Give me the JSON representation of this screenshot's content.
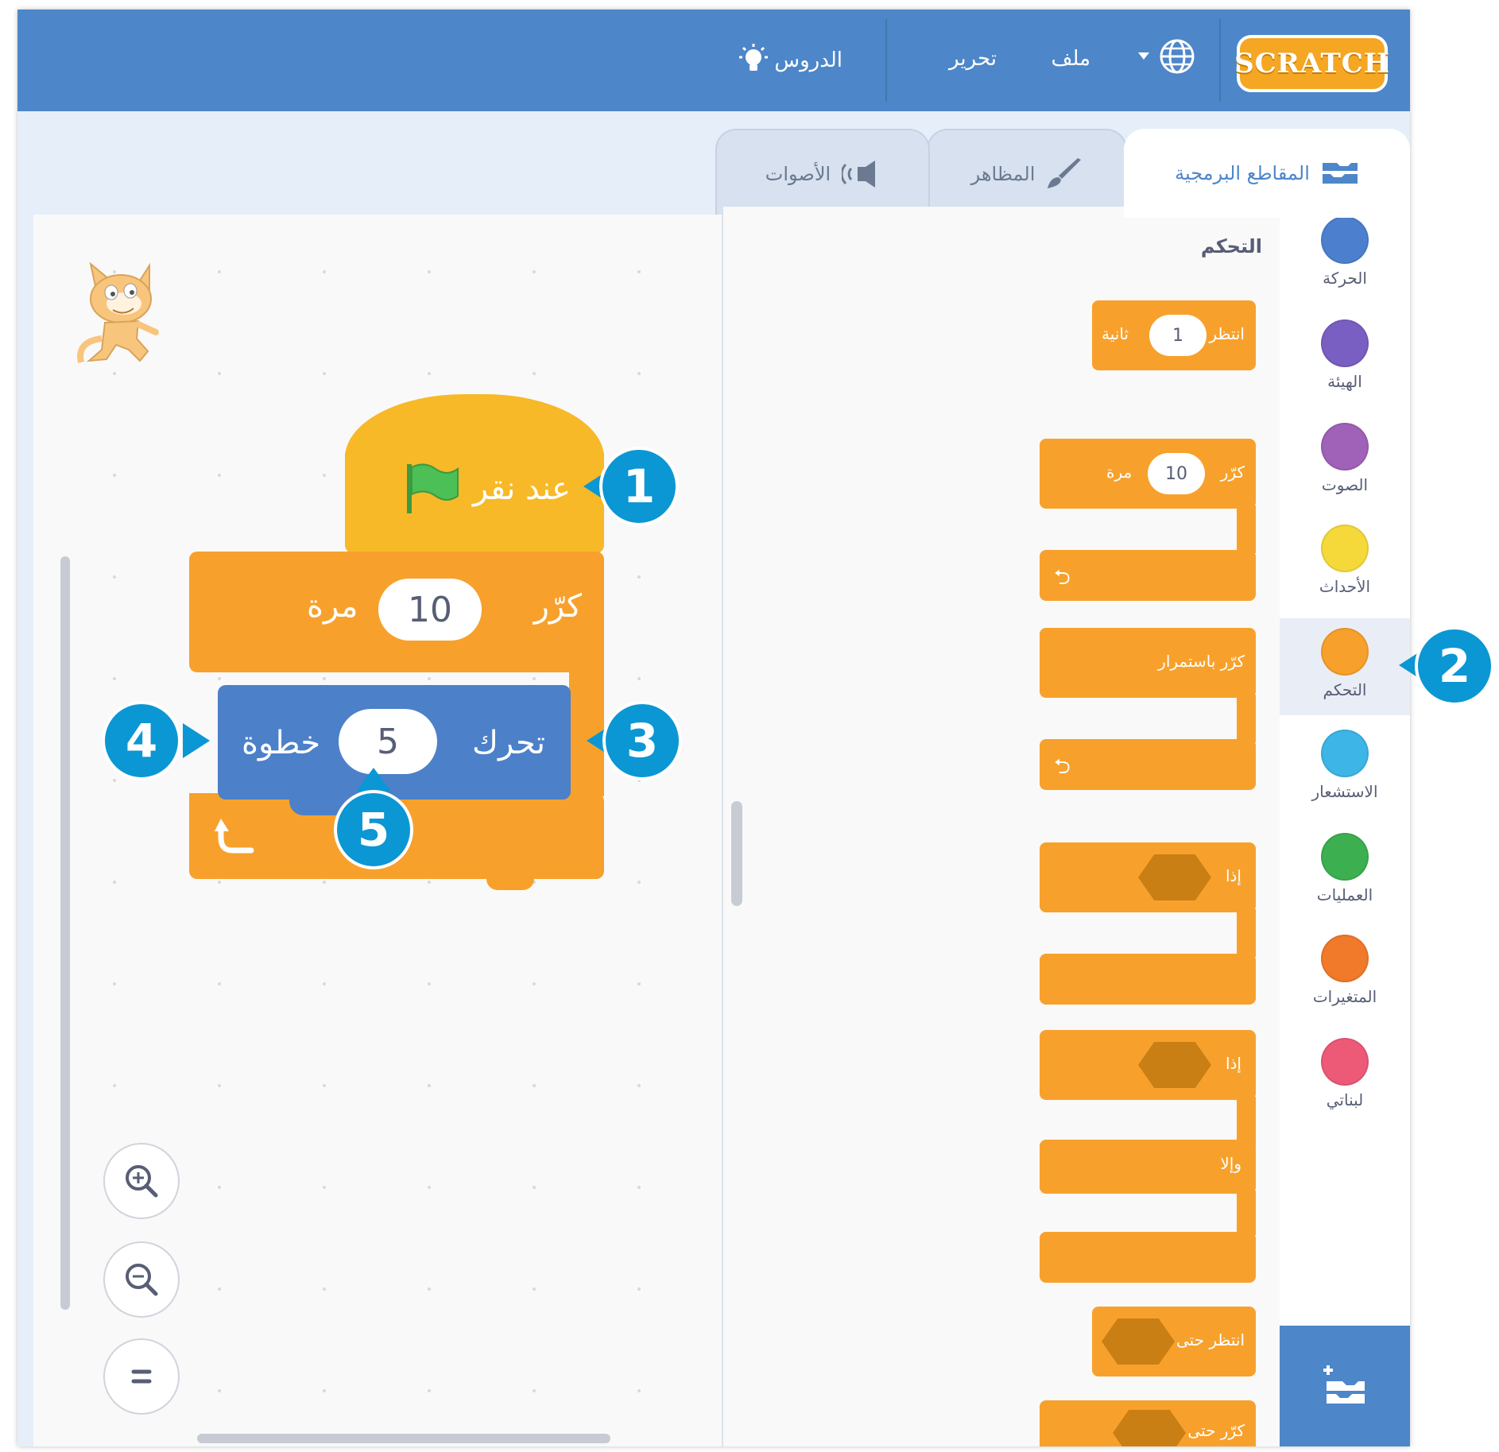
{
  "menubar": {
    "logo": "SCRATCH",
    "file_label": "ملف",
    "edit_label": "تحرير",
    "tutorials_label": "الدروس"
  },
  "tabs": {
    "code": "المقاطع البرمجية",
    "costumes": "المظاهر",
    "sounds": "الأصوات"
  },
  "categories": [
    {
      "label": "الحركة",
      "color": "#4c97ff"
    },
    {
      "label": "الهيئة",
      "color": "#9966ff"
    },
    {
      "label": "الصوت",
      "color": "#cf63cf"
    },
    {
      "label": "الأحداث",
      "color": "#ffd500"
    },
    {
      "label": "التحكم",
      "color": "#ffab19",
      "selected": true
    },
    {
      "label": "الاستشعار",
      "color": "#5cb1d6"
    },
    {
      "label": "العمليات",
      "color": "#59c059"
    },
    {
      "label": "المتغيرات",
      "color": "#ff8c1a"
    },
    {
      "label": "لبناتي",
      "color": "#ff6680"
    }
  ],
  "palette": {
    "title": "التحكم",
    "wait": {
      "label": "انتظر",
      "value": "1",
      "unit": "ثانية"
    },
    "repeat": {
      "label": "كرّر",
      "value": "10",
      "unit": "مرة"
    },
    "forever": {
      "label": "كرّر باستمرار"
    },
    "if": {
      "label": "إذا"
    },
    "if_else": {
      "if_label": "إذا",
      "else_label": "وإلا"
    },
    "wait_until": {
      "label": "انتظر حتى"
    },
    "repeat_until": {
      "label": "كرّر حتى"
    }
  },
  "script": {
    "hat_label": "عند نقر",
    "repeat_label": "كرّر",
    "repeat_value": "10",
    "repeat_unit": "مرة",
    "move_label": "تحرك",
    "move_value": "5",
    "move_unit": "خطوة"
  },
  "callouts": [
    "1",
    "2",
    "3",
    "4",
    "5"
  ],
  "colors": {
    "menubar": "#4d86c9",
    "control": "#f7a12c",
    "motion": "#4c80c9",
    "event": "#f7b928",
    "callout": "#0b97d3"
  }
}
